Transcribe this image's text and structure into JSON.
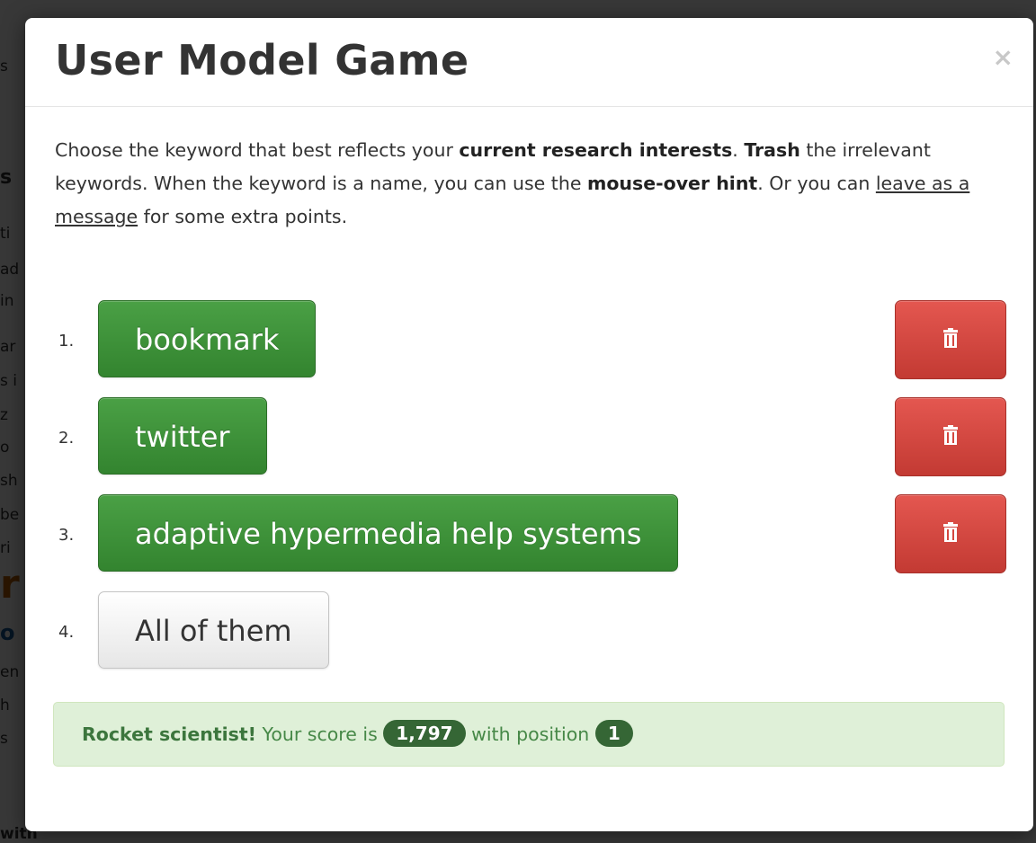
{
  "background": {
    "fragments": [
      "s",
      "s",
      "ti",
      "ad",
      "in",
      "ar",
      "s i",
      "z",
      "o",
      "sh",
      "be",
      "ri",
      "r",
      "o",
      "en",
      "h",
      "s",
      "with"
    ]
  },
  "modal": {
    "title": "User Model Game",
    "close_label": "×",
    "intro": {
      "p1": "Choose the keyword that best reflects your ",
      "b1": "current research interests",
      "p2": ". ",
      "b2": "Trash",
      "p3": " the irrelevant keywords. When the keyword is a name, you can use the ",
      "b3": "mouse-over hint",
      "p4": ". Or you can ",
      "link": "leave as a message",
      "p5": " for some extra points."
    },
    "keywords": [
      {
        "number": "1.",
        "label": "bookmark",
        "trash_icon": "trash-icon"
      },
      {
        "number": "2.",
        "label": "twitter",
        "trash_icon": "trash-icon"
      },
      {
        "number": "3.",
        "label": "adaptive hypermedia help systems",
        "trash_icon": "trash-icon"
      },
      {
        "number": "4.",
        "label": "All of them"
      }
    ],
    "alert": {
      "title": "Rocket scientist!",
      "text1": " Your score is ",
      "score": "1,797",
      "text2": " with position ",
      "position": "1"
    }
  },
  "colors": {
    "keyword_button": "#3d9440",
    "trash_button": "#d4473f",
    "alert_bg": "#dff0d8",
    "badge": "#356635"
  }
}
